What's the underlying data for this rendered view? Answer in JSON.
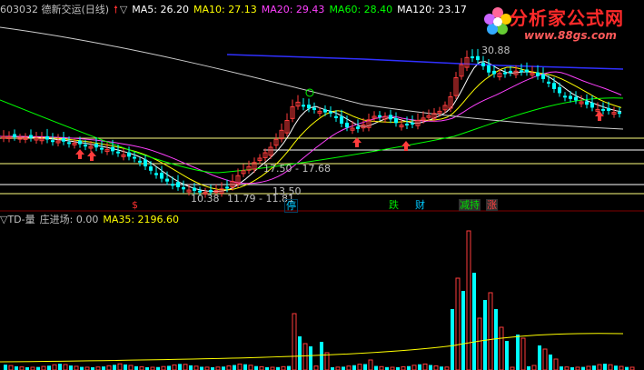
{
  "header": {
    "code_title": "603032 德新交运(日线)",
    "ma5": "MA5: 26.20",
    "ma10": "MA10: 27.13",
    "ma20": "MA20: 29.43",
    "ma60": "MA60: 28.40",
    "ma120": "MA120: 23.17",
    "triangle": "▽"
  },
  "price_labels": {
    "top": "30.88",
    "low": "10.38",
    "range1": "17.50 - 17.68",
    "range2": "11.79 - 11.81",
    "range3": "13.50"
  },
  "badges": [
    {
      "text": "停",
      "color": "#00c8ff"
    },
    {
      "text": "跌",
      "color": "#00e000"
    },
    {
      "text": "财",
      "color": "#00c8ff"
    },
    {
      "text": "减持",
      "color": "#00e000"
    },
    {
      "text": "涨",
      "color": "#ff4040"
    }
  ],
  "volume": {
    "title": "▽TD-量",
    "zhuang": "庄进场: 0.00",
    "ma35": "MA35: 2196.60"
  },
  "watermark": {
    "title": "分析家公式网",
    "url": "www.88gs.com"
  },
  "colors": {
    "up": "#ff3c3c",
    "down": "#00ffff",
    "ma5": "#ffffff",
    "ma10": "#ffff00",
    "ma20": "#ff40ff",
    "ma60": "#00ff00",
    "ma120": "#ffffff",
    "long": "#3030ff"
  }
}
